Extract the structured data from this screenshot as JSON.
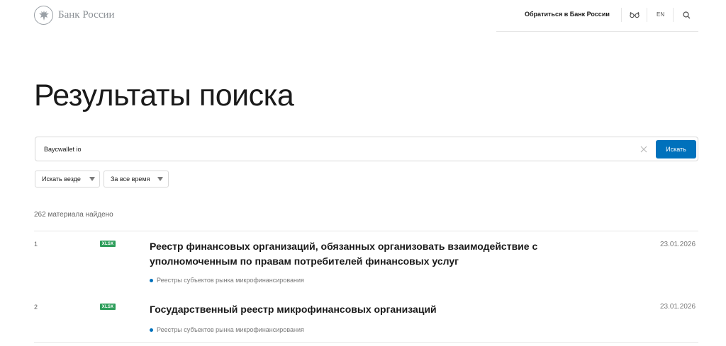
{
  "header": {
    "logo_text": "Банк России",
    "contact_label": "Обратиться в Банк России",
    "lang_label": "EN"
  },
  "page": {
    "title": "Результаты поиска"
  },
  "search": {
    "value": "Baycwallet io",
    "submit_label": "Искать"
  },
  "filters": [
    {
      "label": "Искать везде"
    },
    {
      "label": "За все время"
    }
  ],
  "results_count": "262 материала найдено",
  "results": [
    {
      "num": "1",
      "badge": "XLSX",
      "title": "Реестр финансовых организаций, обязанных организовать взаимодействие с уполномоченным по правам потребителей финансовых услуг",
      "date": "23.01.2026",
      "tag": "Реестры субъектов рынка микрофинансирования"
    },
    {
      "num": "2",
      "badge": "XLSX",
      "title": "Государственный реестр микрофинансовых организаций",
      "date": "23.01.2026",
      "tag": "Реестры субъектов рынка микрофинансирования"
    }
  ],
  "colors": {
    "accent": "#0071bc",
    "badge": "#2e9e5b"
  }
}
